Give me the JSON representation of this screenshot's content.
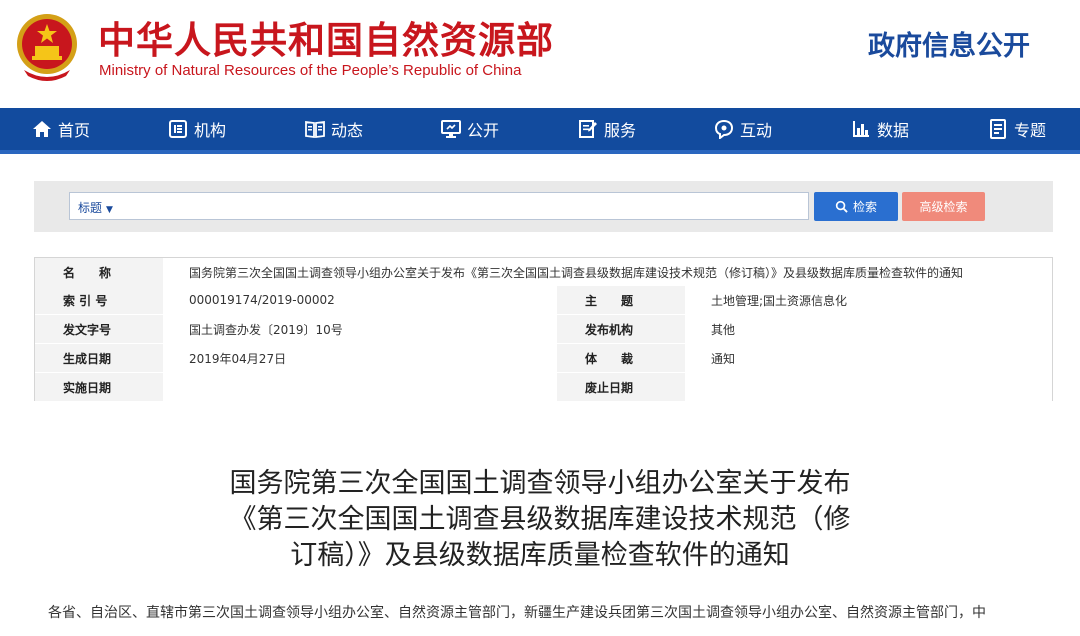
{
  "header": {
    "title_cn": "中华人民共和国自然资源部",
    "title_en": "Ministry of Natural Resources of the People’s Republic of China",
    "right_label": "政府信息公开"
  },
  "nav": {
    "items": [
      {
        "label": "首页",
        "icon": "home-icon"
      },
      {
        "label": "机构",
        "icon": "org-icon"
      },
      {
        "label": "动态",
        "icon": "book-icon"
      },
      {
        "label": "公开",
        "icon": "monitor-icon"
      },
      {
        "label": "服务",
        "icon": "edit-icon"
      },
      {
        "label": "互动",
        "icon": "chat-icon"
      },
      {
        "label": "数据",
        "icon": "bar-chart-icon"
      },
      {
        "label": "专题",
        "icon": "document-icon"
      }
    ]
  },
  "search": {
    "type_label": "标题",
    "search_label": "检索",
    "advanced_label": "高级检索"
  },
  "info": {
    "name_label": "名　　称",
    "name_value": "国务院第三次全国国土调查领导小组办公室关于发布《第三次全国国土调查县级数据库建设技术规范（修订稿）》及县级数据库质量检查软件的通知",
    "index_label": "索 引 号",
    "index_value": "000019174/2019-00002",
    "subject_label": "主　　题",
    "subject_value": "土地管理;国土资源信息化",
    "doc_no_label": "发文字号",
    "doc_no_value": "国土调查办发〔2019〕10号",
    "publisher_label": "发布机构",
    "publisher_value": "其他",
    "date_label": "生成日期",
    "date_value": "2019年04月27日",
    "genre_label": "体　　裁",
    "genre_value": "通知",
    "impl_label": "实施日期",
    "impl_value": "",
    "expire_label": "废止日期",
    "expire_value": ""
  },
  "article": {
    "title_line1": "国务院第三次全国国土调查领导小组办公室关于发布",
    "title_line2": "《第三次全国国土调查县级数据库建设技术规范（修",
    "title_line3": "订稿）》及县级数据库质量检查软件的通知",
    "body_line1": "各省、自治区、直辖市第三次国土调查领导小组办公室、自然资源主管部门，新疆生产建设兵团第三次国土调查领导小组办公室、自然资源主管部门，中"
  },
  "colors": {
    "brand_red": "#c8161d",
    "nav_blue": "#124b9e",
    "search_blue": "#2a6fd0",
    "advanced_salmon": "#f08a7b"
  }
}
